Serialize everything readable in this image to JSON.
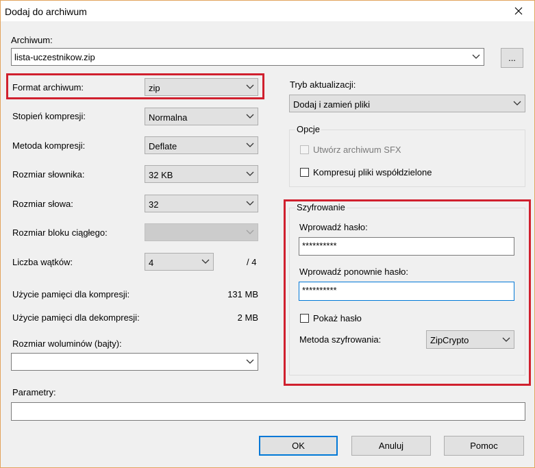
{
  "window": {
    "title": "Dodaj do archiwum"
  },
  "archive": {
    "label": "Archiwum:",
    "value": "lista-uczestnikow.zip",
    "browse_label": "..."
  },
  "format": {
    "label": "Format archiwum:",
    "value": "zip"
  },
  "compression_level": {
    "label": "Stopień kompresji:",
    "value": "Normalna"
  },
  "compression_method": {
    "label": "Metoda kompresji:",
    "value": "Deflate"
  },
  "dictionary_size": {
    "label": "Rozmiar słownika:",
    "value": "32 KB"
  },
  "word_size": {
    "label": "Rozmiar słowa:",
    "value": "32"
  },
  "solid_block": {
    "label": "Rozmiar bloku ciągłego:",
    "value": ""
  },
  "threads": {
    "label": "Liczba wątków:",
    "value": "4",
    "max": "/ 4"
  },
  "memory": {
    "compress_label": "Użycie pamięci dla kompresji:",
    "compress_value": "131 MB",
    "decompress_label": "Użycie pamięci dla dekompresji:",
    "decompress_value": "2 MB"
  },
  "volumes": {
    "label": "Rozmiar woluminów (bajty):",
    "value": ""
  },
  "parameters": {
    "label": "Parametry:",
    "value": ""
  },
  "update_mode": {
    "label": "Tryb aktualizacji:",
    "value": "Dodaj i zamień pliki"
  },
  "options": {
    "title": "Opcje",
    "sfx_label": "Utwórz archiwum SFX",
    "shared_label": "Kompresuj pliki współdzielone"
  },
  "encryption": {
    "title": "Szyfrowanie",
    "password_label": "Wprowadź hasło:",
    "password_value": "**********",
    "reenter_label": "Wprowadź ponownie hasło:",
    "reenter_value": "**********",
    "show_label": "Pokaż hasło",
    "method_label": "Metoda szyfrowania:",
    "method_value": "ZipCrypto"
  },
  "buttons": {
    "ok": "OK",
    "cancel": "Anuluj",
    "help": "Pomoc"
  },
  "colors": {
    "highlight": "#d0202e",
    "focus": "#0078d7",
    "window_border": "#e2a35c"
  }
}
